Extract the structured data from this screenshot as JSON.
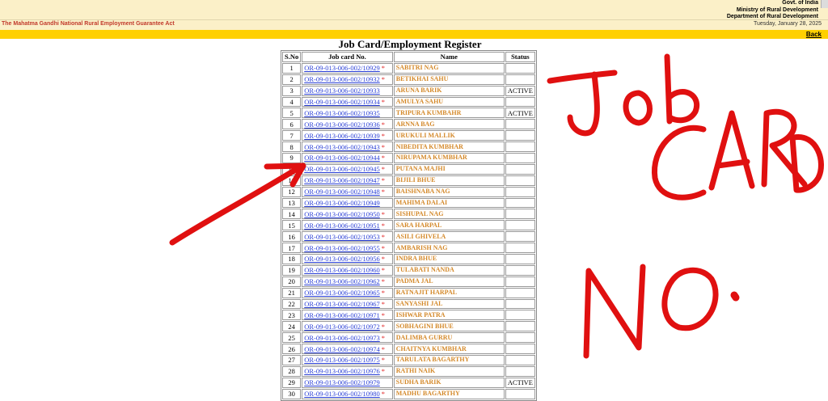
{
  "header": {
    "gov_lines": [
      "Govt. of India",
      "Ministry of Rural Development",
      "Department of Rural Development"
    ],
    "act_title": "The Mahatma Gandhi National Rural Employment Guarantee Act",
    "date": "Tuesday, January 28, 2025",
    "back_label": "Back"
  },
  "page_title": "Job Card/Employment Register",
  "table": {
    "columns": [
      "S.No",
      "Job card No.",
      "Name",
      "Status"
    ],
    "rows": [
      {
        "sno": "1",
        "job": "OR-09-013-006-002/10929",
        "star": "*",
        "name": "SABITRI NAG",
        "status": ""
      },
      {
        "sno": "2",
        "job": "OR-09-013-006-002/10932",
        "star": "*",
        "name": "BETIKHAI SAHU",
        "status": ""
      },
      {
        "sno": "3",
        "job": "OR-09-013-006-002/10933",
        "star": "",
        "name": "ARUNA BARIK",
        "status": "ACTIVE"
      },
      {
        "sno": "4",
        "job": "OR-09-013-006-002/10934",
        "star": "*",
        "name": "AMULYA SAHU",
        "status": ""
      },
      {
        "sno": "5",
        "job": "OR-09-013-006-002/10935",
        "star": "",
        "name": "TRIPURA KUMBAHR",
        "status": "ACTIVE"
      },
      {
        "sno": "6",
        "job": "OR-09-013-006-002/10936",
        "star": "*",
        "name": "ARNNA BAG",
        "status": ""
      },
      {
        "sno": "7",
        "job": "OR-09-013-006-002/10939",
        "star": "*",
        "name": "URUKULI MALLIK",
        "status": ""
      },
      {
        "sno": "8",
        "job": "OR-09-013-006-002/10943",
        "star": "*",
        "name": "NIBEDITA KUMBHAR",
        "status": ""
      },
      {
        "sno": "9",
        "job": "OR-09-013-006-002/10944",
        "star": "*",
        "name": "NIRUPAMA KUMBHAR",
        "status": ""
      },
      {
        "sno": "10",
        "job": "OR-09-013-006-002/10945",
        "star": "*",
        "name": "PUTANA MAJHI",
        "status": ""
      },
      {
        "sno": "11",
        "job": "OR-09-013-006-002/10947",
        "star": "*",
        "name": "BIJILI BHUE",
        "status": ""
      },
      {
        "sno": "12",
        "job": "OR-09-013-006-002/10948",
        "star": "*",
        "name": "BAISHNABA NAG",
        "status": ""
      },
      {
        "sno": "13",
        "job": "OR-09-013-006-002/10949",
        "star": "",
        "name": "MAHIMA DALAI",
        "status": ""
      },
      {
        "sno": "14",
        "job": "OR-09-013-006-002/10950",
        "star": "*",
        "name": "SISHUPAL NAG",
        "status": ""
      },
      {
        "sno": "15",
        "job": "OR-09-013-006-002/10951",
        "star": "*",
        "name": "SARA HARPAL",
        "status": ""
      },
      {
        "sno": "16",
        "job": "OR-09-013-006-002/10953",
        "star": "*",
        "name": "ASILI GHIVELA",
        "status": ""
      },
      {
        "sno": "17",
        "job": "OR-09-013-006-002/10955",
        "star": "*",
        "name": "AMBARISH NAG",
        "status": ""
      },
      {
        "sno": "18",
        "job": "OR-09-013-006-002/10956",
        "star": "*",
        "name": "INDRA BHUE",
        "status": ""
      },
      {
        "sno": "19",
        "job": "OR-09-013-006-002/10960",
        "star": "*",
        "name": "TULABATI NANDA",
        "status": ""
      },
      {
        "sno": "20",
        "job": "OR-09-013-006-002/10962",
        "star": "*",
        "name": "PADMA JAL",
        "status": ""
      },
      {
        "sno": "21",
        "job": "OR-09-013-006-002/10965",
        "star": "*",
        "name": "RATNAJIT HARPAL",
        "status": ""
      },
      {
        "sno": "22",
        "job": "OR-09-013-006-002/10967",
        "star": "*",
        "name": "SANYASHI JAL",
        "status": ""
      },
      {
        "sno": "23",
        "job": "OR-09-013-006-002/10971",
        "star": "*",
        "name": "ISHWAR PATRA",
        "status": ""
      },
      {
        "sno": "24",
        "job": "OR-09-013-006-002/10972",
        "star": "*",
        "name": "SOBHAGINI BHUE",
        "status": ""
      },
      {
        "sno": "25",
        "job": "OR-09-013-006-002/10973",
        "star": "*",
        "name": "DALIMBA GURRU",
        "status": ""
      },
      {
        "sno": "26",
        "job": "OR-09-013-006-002/10974",
        "star": "*",
        "name": "CHAITNYA KUMBHAR",
        "status": ""
      },
      {
        "sno": "27",
        "job": "OR-09-013-006-002/10975",
        "star": "*",
        "name": "TARULATA BAGARTHY",
        "status": ""
      },
      {
        "sno": "28",
        "job": "OR-09-013-006-002/10976",
        "star": "*",
        "name": "RATHI NAIK",
        "status": ""
      },
      {
        "sno": "29",
        "job": "OR-09-013-006-002/10979",
        "star": "",
        "name": "SUDHA BARIK",
        "status": "ACTIVE"
      },
      {
        "sno": "30",
        "job": "OR-09-013-006-002/10980",
        "star": "*",
        "name": "MADHU BAGARTHY",
        "status": ""
      }
    ]
  },
  "annotation": {
    "color": "#e01010",
    "handwriting": "Job CARD NO."
  }
}
